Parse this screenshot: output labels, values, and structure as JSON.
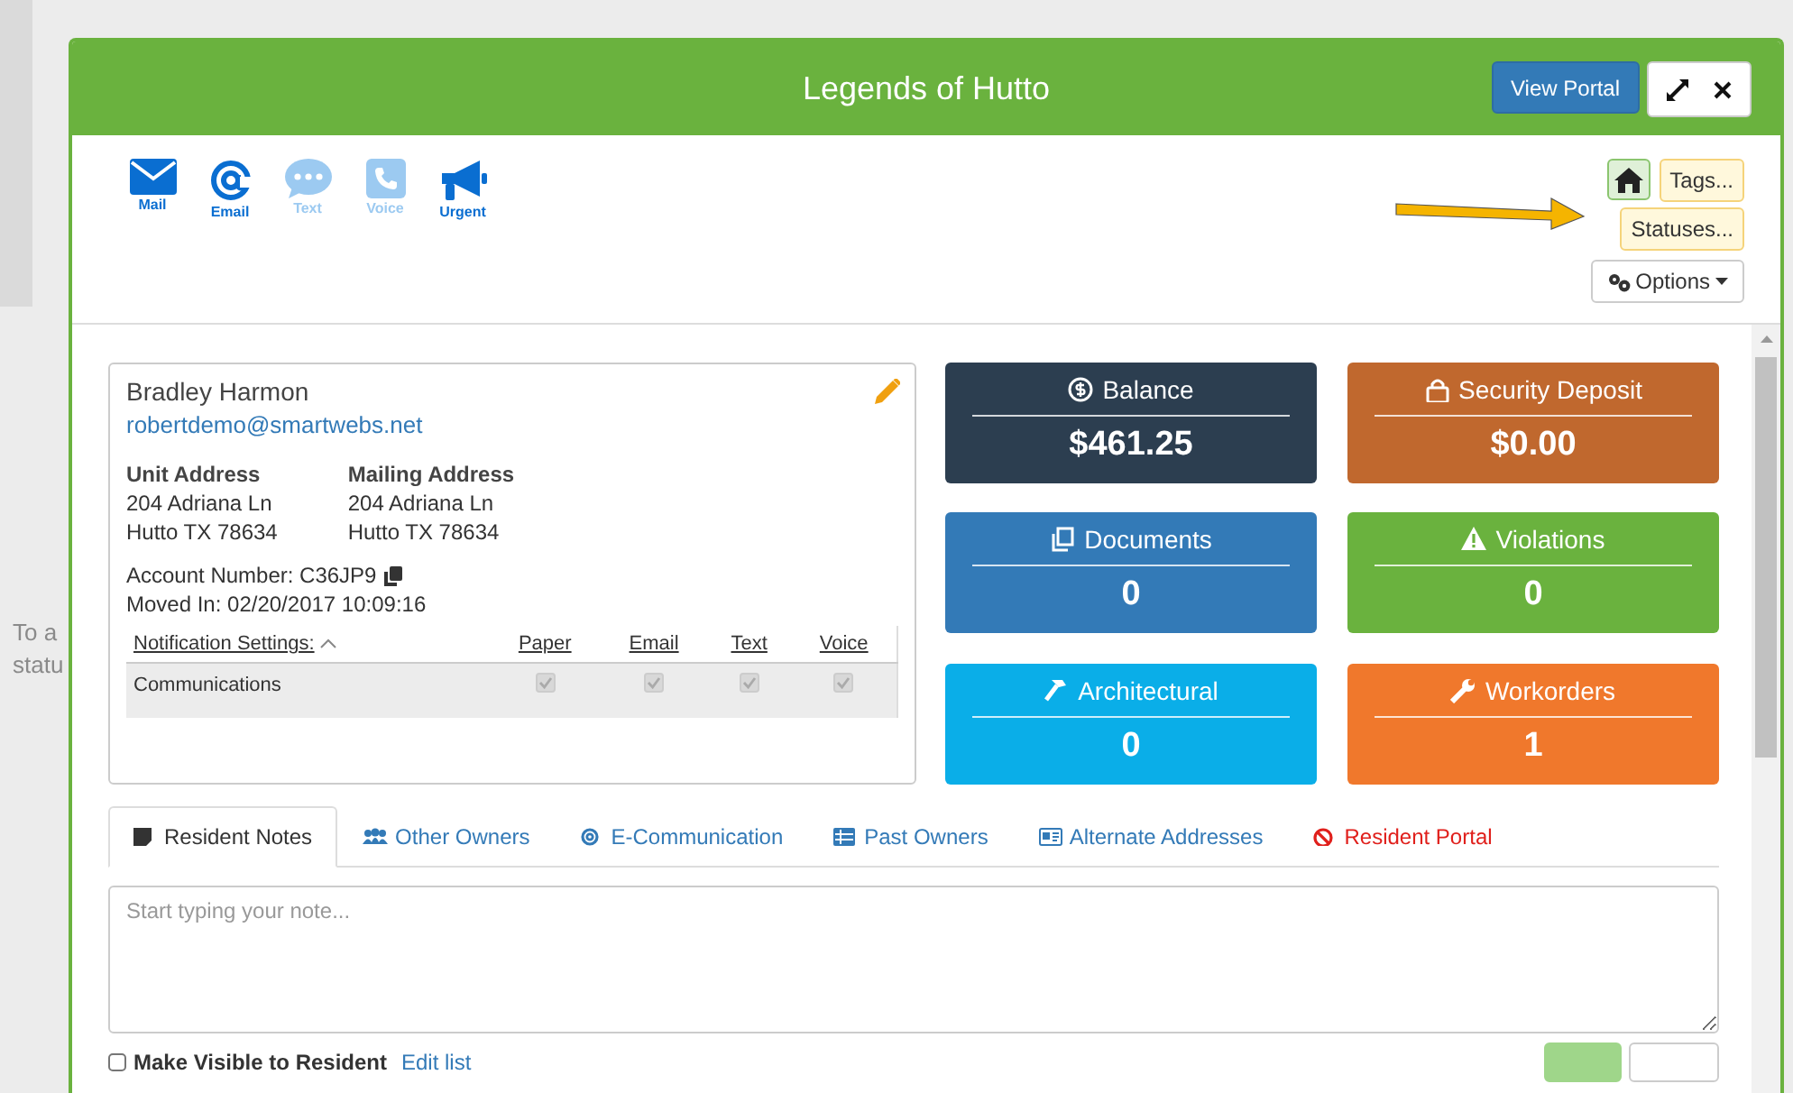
{
  "backdrop": {
    "text_lines": [
      "To a",
      "statu"
    ]
  },
  "window": {
    "title": "Legends of Hutto",
    "portal_button": "View Portal"
  },
  "channels": [
    {
      "label": "Mail",
      "kind": "mail",
      "enabled": true
    },
    {
      "label": "Email",
      "kind": "at",
      "enabled": true
    },
    {
      "label": "Text",
      "kind": "chat",
      "enabled": false
    },
    {
      "label": "Voice",
      "kind": "phone",
      "enabled": false
    },
    {
      "label": "Urgent",
      "kind": "megaphone",
      "enabled": true
    }
  ],
  "tags_button": "Tags...",
  "statuses_button": "Statuses...",
  "options_button": "Options",
  "resident": {
    "name": "Bradley Harmon",
    "email": "robertdemo@smartwebs.net",
    "addresses": [
      {
        "heading": "Unit Address",
        "lines": [
          "204 Adriana Ln",
          "Hutto TX 78634"
        ]
      },
      {
        "heading": "Mailing Address",
        "lines": [
          "204 Adriana Ln",
          "Hutto TX 78634"
        ]
      }
    ],
    "account_number": "Account Number: C36JP9",
    "moved_in": "Moved In: 02/20/2017 10:09:16"
  },
  "notification_settings": {
    "columns": [
      "Notification Settings:",
      "Paper",
      "Email",
      "Text",
      "Voice"
    ],
    "rows": [
      {
        "name": "Communications",
        "checks": [
          {
            "checked": true
          },
          {
            "checked": true
          },
          {
            "checked": true
          },
          {
            "checked": true
          }
        ]
      }
    ]
  },
  "tiles": [
    {
      "title": "Balance",
      "value": "$461.25",
      "color": "#2c3e50"
    },
    {
      "title": "Security Deposit",
      "value": "$0.00",
      "color": "#c0682e"
    },
    {
      "title": "Documents",
      "value": "0",
      "color": "#337ab7"
    },
    {
      "title": "Violations",
      "value": "0",
      "color": "#6ab23e"
    },
    {
      "title": "Architectural",
      "value": "0",
      "color": "#0aaee8"
    },
    {
      "title": "Workorders",
      "value": "1",
      "color": "#f0782c"
    }
  ],
  "tabs": [
    {
      "label": "Resident Notes",
      "selected": true,
      "kind": "normal"
    },
    {
      "label": "Other Owners",
      "selected": false,
      "kind": "normal"
    },
    {
      "label": "E-Communication",
      "selected": false,
      "kind": "normal"
    },
    {
      "label": "Past Owners",
      "selected": false,
      "kind": "normal"
    },
    {
      "label": "Alternate Addresses",
      "selected": false,
      "kind": "normal"
    },
    {
      "label": "Resident Portal",
      "selected": false,
      "kind": "danger"
    }
  ],
  "note": {
    "placeholder": "Start typing your note..."
  },
  "visible_to_resident": {
    "label": "Make Visible to Resident",
    "checked": false
  },
  "edit_link": "Edit list",
  "footer_buttons": [
    {
      "kind": "primary"
    },
    {
      "kind": "default"
    }
  ]
}
